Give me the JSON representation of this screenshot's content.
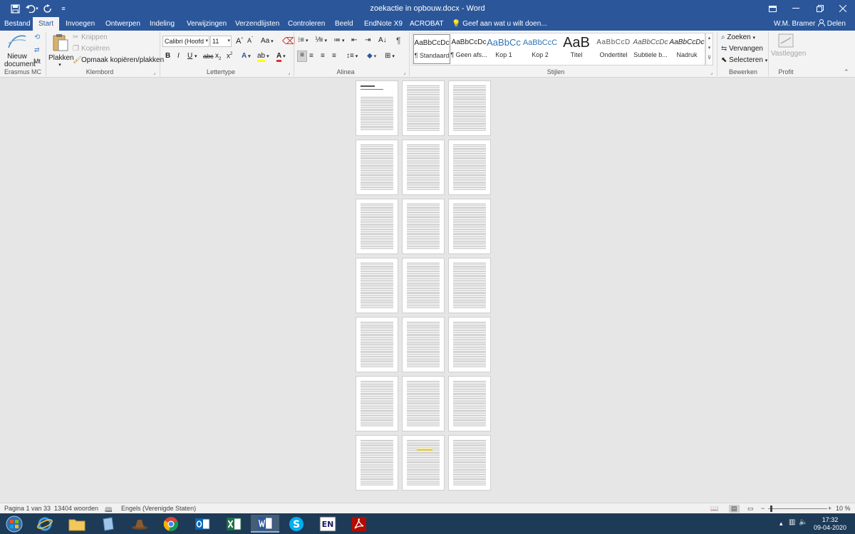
{
  "window": {
    "title": "zoekactie in opbouw.docx - Word"
  },
  "tabs": [
    "Bestand",
    "Start",
    "Invoegen",
    "Ontwerpen",
    "Indeling",
    "Verwijzingen",
    "Verzendlijsten",
    "Controleren",
    "Beeld",
    "EndNote X9",
    "ACROBAT"
  ],
  "tell_me": "Geef aan wat u wilt doen...",
  "user": "W.M. Bramer",
  "share": "Delen",
  "ribbon": {
    "erasmus": {
      "btn": "Nieuw",
      "btn2": "document",
      "extra": "Mt",
      "label": "Erasmus MC"
    },
    "clipboard": {
      "paste": "Plakken",
      "cut": "Knippen",
      "copy": "Kopiëren",
      "format_painter": "Opmaak kopiëren/plakken",
      "label": "Klembord"
    },
    "font": {
      "name": "Calibri (Hoofd",
      "size": "11",
      "grow": "A",
      "shrink": "A",
      "case": "Aa",
      "bold": "B",
      "italic": "I",
      "underline": "U",
      "strike": "abc",
      "sub": "x",
      "sup": "x",
      "label": "Lettertype"
    },
    "paragraph": {
      "label": "Alinea",
      "pilcrow": "¶"
    },
    "styles": {
      "label": "Stijlen",
      "items": [
        {
          "preview": "AaBbCcDc",
          "name": "¶ Standaard"
        },
        {
          "preview": "AaBbCcDc",
          "name": "¶ Geen afs..."
        },
        {
          "preview": "AaBbCc",
          "name": "Kop 1"
        },
        {
          "preview": "AaBbCcC",
          "name": "Kop 2"
        },
        {
          "preview": "AaB",
          "name": "Titel"
        },
        {
          "preview": "AaBbCcD",
          "name": "Ondertitel"
        },
        {
          "preview": "AaBbCcDc",
          "name": "Subtiele b..."
        },
        {
          "preview": "AaBbCcDc",
          "name": "Nadruk"
        }
      ]
    },
    "editing": {
      "find": "Zoeken",
      "replace": "Vervangen",
      "select": "Selecteren",
      "label": "Bewerken"
    },
    "profit": {
      "btn": "Vastleggen",
      "label": "Profit"
    }
  },
  "status": {
    "page": "Pagina 1 van 33",
    "words": "13404 woorden",
    "language": "Engels (Verenigde Staten)",
    "zoom": "10 %"
  },
  "clock": {
    "time": "17:32",
    "date": "09-04-2020"
  },
  "colors": {
    "word_blue": "#2b579a",
    "ribbon_bg": "#f3f3f3",
    "doc_bg": "#e6e6e6",
    "taskbar": "#1d3a57"
  },
  "icons": [
    "save-icon",
    "undo-icon",
    "redo-icon",
    "customize-icon",
    "lightbulb-icon",
    "person-icon",
    "paste-icon",
    "scissors-icon",
    "copy-icon",
    "brush-icon",
    "search-icon",
    "replace-icon",
    "select-icon",
    "start-icon",
    "ie-icon",
    "explorer-icon",
    "chrome-icon",
    "outlook-icon",
    "excel-icon",
    "word-icon",
    "skype-icon",
    "endnote-icon",
    "acrobat-icon"
  ]
}
